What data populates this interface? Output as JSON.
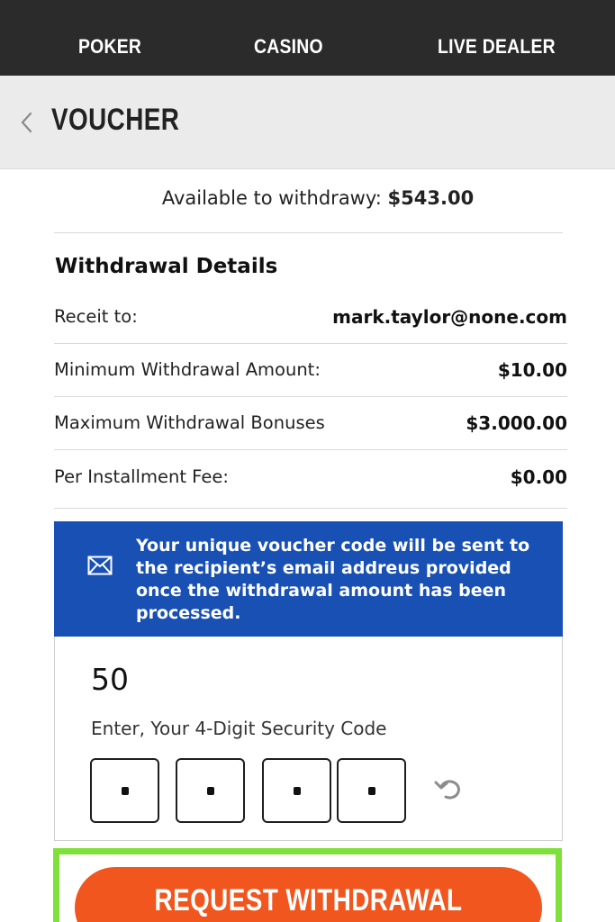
{
  "topnav": {
    "items": [
      {
        "label": "POKER"
      },
      {
        "label": "CASINO"
      },
      {
        "label": "LIVE DEALER"
      }
    ]
  },
  "header": {
    "back_icon": "chevron-left-icon",
    "title": "VOUCHER"
  },
  "available": {
    "label": "Available to withdrawy:",
    "amount": "$543.00"
  },
  "details": {
    "title": "Withdrawal Details",
    "rows": [
      {
        "label": "Receit to:",
        "value": "mark.taylor@none.com"
      },
      {
        "label": "Minimum Withdrawal Amount:",
        "value": "$10.00"
      },
      {
        "label": "Maximum Withdrawal Bonuses",
        "value": "$3.000.00"
      },
      {
        "label": "Per Installment Fee:",
        "value": "$0.00"
      }
    ]
  },
  "notice": {
    "icon": "mail-icon",
    "text": "Your unique voucher code will be sent to the recipient’s email addreus provided once the withdrawal amount has been processed.",
    "background": "#1950b4"
  },
  "form": {
    "amount_value": "50",
    "code_label": "Enter, Your 4-Digit Security Code",
    "code_digits": [
      "•",
      "•",
      "•",
      "•"
    ],
    "reset_icon": "undo-icon"
  },
  "cta": {
    "label": "REQUEST WITHDRAWAL",
    "color": "#f0561e",
    "highlight_color": "#7fe03a"
  }
}
